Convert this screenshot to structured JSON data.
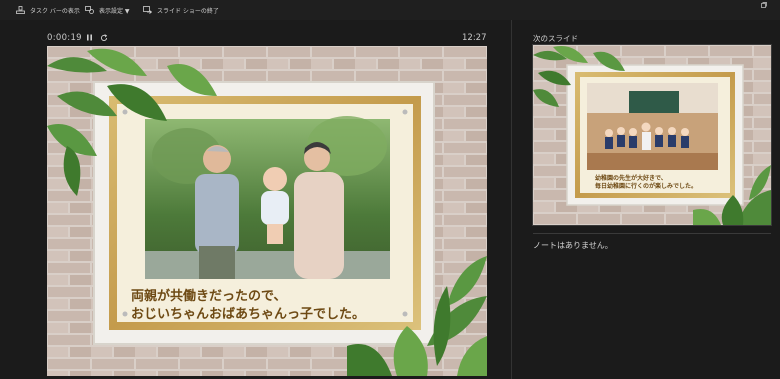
{
  "toolbar": {
    "taskbar_label": "タスク バーの表示",
    "display_settings_label": "表示設定 ▼",
    "end_slideshow_label": "スライド ショーの終了"
  },
  "presenter": {
    "elapsed_time": "0:00:19",
    "clock": "12:27",
    "pause_icon": "pause-icon",
    "restart_icon": "restart-icon"
  },
  "current_slide": {
    "caption_line1": "両親が共働きだったので、",
    "caption_line2": "おじいちゃんおばあちゃんっ子でした。"
  },
  "next_slide": {
    "heading": "次のスライド",
    "caption_line1": "幼稚園の先生が大好きで、",
    "caption_line2": "毎日幼稚園に行くのが楽しみでした。"
  },
  "notes": {
    "text": "ノートはありません。"
  },
  "colors": {
    "background": "#1b1b1b",
    "frame_gold": "#c9a55a",
    "caption_brown": "#6e4a14"
  }
}
